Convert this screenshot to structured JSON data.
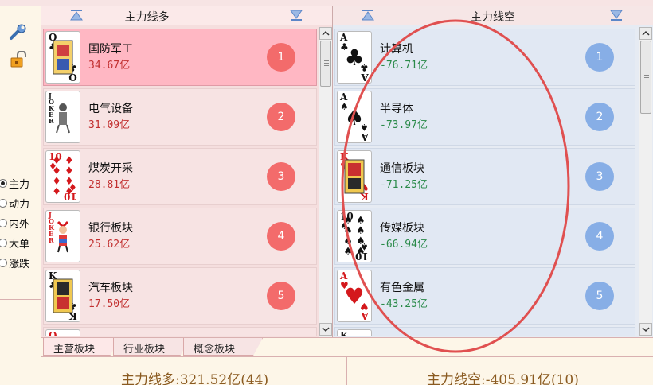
{
  "sidebar": {
    "tools": [
      {
        "icon": "wrench-icon"
      },
      {
        "icon": "lock-icon"
      }
    ],
    "radio_options": [
      {
        "label": "主力",
        "selected": true
      },
      {
        "label": "动力",
        "selected": false
      },
      {
        "label": "内外",
        "selected": false
      },
      {
        "label": "大单",
        "selected": false
      },
      {
        "label": "涨跌",
        "selected": false
      }
    ]
  },
  "left_panel": {
    "title": "主力线多",
    "rows": [
      {
        "rank": "1",
        "name": "国防军工",
        "amount": "34.67亿",
        "card": "Q♣"
      },
      {
        "rank": "2",
        "name": "电气设备",
        "amount": "31.09亿",
        "card": "JOKER"
      },
      {
        "rank": "3",
        "name": "煤炭开采",
        "amount": "28.81亿",
        "card": "10♦"
      },
      {
        "rank": "4",
        "name": "银行板块",
        "amount": "25.62亿",
        "card": "JOKER"
      },
      {
        "rank": "5",
        "name": "汽车板块",
        "amount": "17.50亿",
        "card": "K♣"
      }
    ],
    "partial_card": "Q"
  },
  "right_panel": {
    "title": "主力线空",
    "rows": [
      {
        "rank": "1",
        "name": "计算机",
        "amount": "-76.71亿",
        "card": "A♣"
      },
      {
        "rank": "2",
        "name": "半导体",
        "amount": "-73.97亿",
        "card": "A♠"
      },
      {
        "rank": "3",
        "name": "通信板块",
        "amount": "-71.25亿",
        "card": "K♥"
      },
      {
        "rank": "4",
        "name": "传媒板块",
        "amount": "-66.94亿",
        "card": "10♠"
      },
      {
        "rank": "5",
        "name": "有色金属",
        "amount": "-43.25亿",
        "card": "A♥"
      }
    ],
    "partial_card": "K"
  },
  "tabs": [
    {
      "label": "主营板块",
      "active": true
    },
    {
      "label": "行业板块",
      "active": false
    },
    {
      "label": "概念板块",
      "active": false
    }
  ],
  "summary": {
    "long": "主力线多:321.52亿(44)",
    "short": "主力线空:-405.91亿(10)"
  },
  "colors": {
    "long_rank": "#f36b6b",
    "short_rank": "#87aee6",
    "long_amount": "#c23030",
    "short_amount": "#2a8a4a",
    "annotation": "#e05050"
  }
}
